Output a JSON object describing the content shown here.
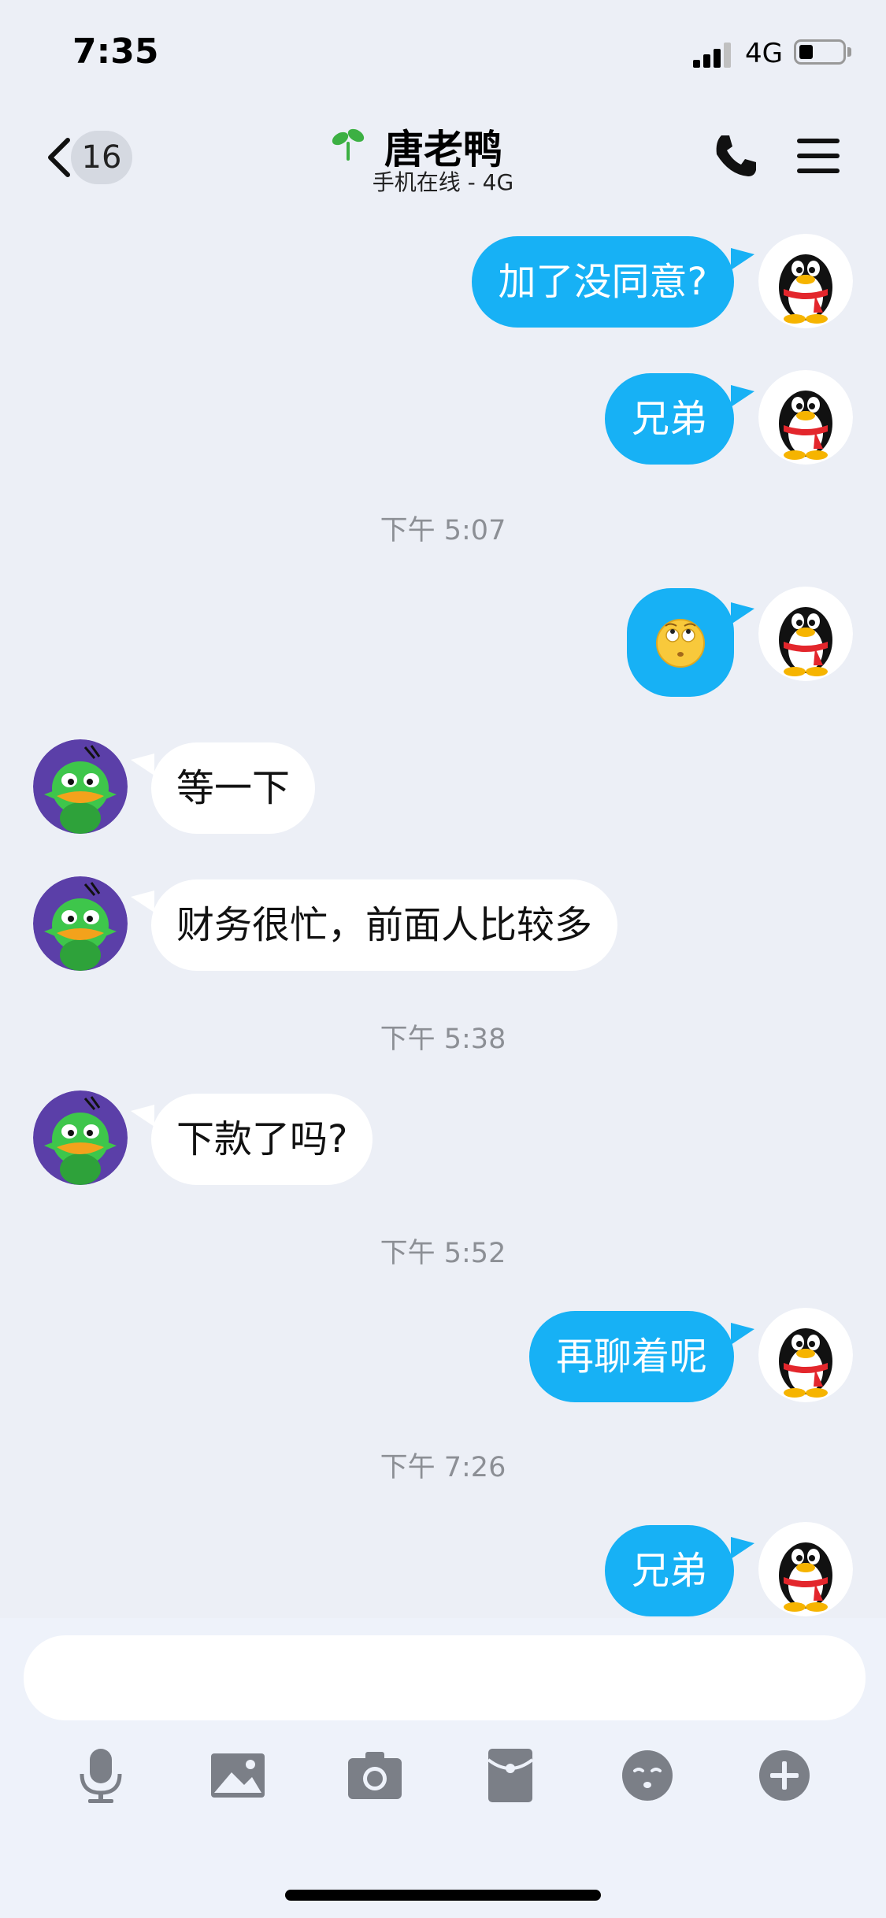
{
  "status_bar": {
    "time": "7:35",
    "network": "4G",
    "battery_level": 0.3
  },
  "nav": {
    "unread_count": "16",
    "contact_name": "唐老鸭",
    "contact_status": "手机在线 - 4G"
  },
  "messages": {
    "m1": "加了没同意?",
    "m2": "兄弟",
    "ts1": "下午 5:07",
    "m3": "",
    "m4": "等一下",
    "m5": "财务很忙，前面人比较多",
    "ts2": "下午 5:38",
    "m6": "下款了吗?",
    "ts3": "下午 5:52",
    "m7": "再聊着呢",
    "ts4": "下午 7:26",
    "m8": "兄弟"
  },
  "composer": {
    "input_value": "",
    "toolbar": [
      "microphone-icon",
      "image-icon",
      "camera-icon",
      "red-packet-icon",
      "emoji-icon",
      "plus-icon"
    ]
  },
  "colors": {
    "accent": "#17b1f5",
    "background": "#eceff6",
    "incoming_bubble": "#ffffff",
    "timestamp": "#8c8f95"
  }
}
